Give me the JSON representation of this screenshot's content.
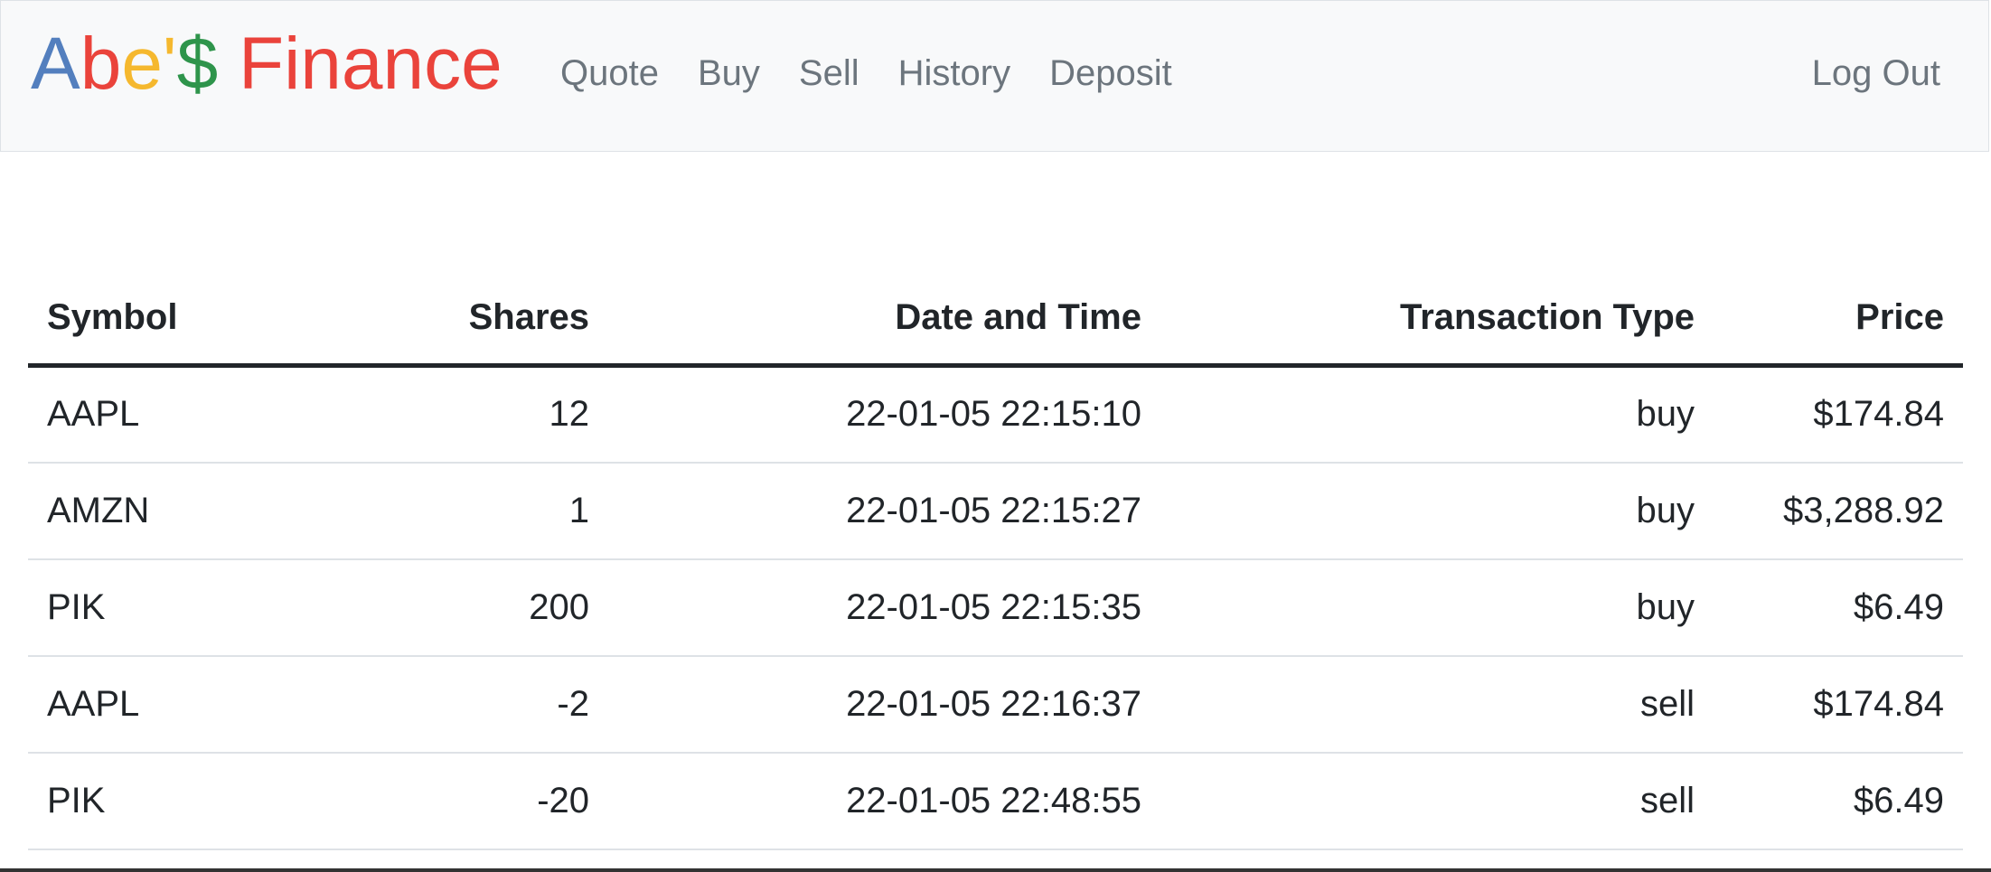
{
  "brand": {
    "letters": [
      {
        "char": "A",
        "color": "#537fbe"
      },
      {
        "char": "b",
        "color": "#ea433b"
      },
      {
        "char": "e",
        "color": "#f5b82e"
      },
      {
        "char": "'",
        "color": "#f5b82e"
      },
      {
        "char": "$",
        "color": "#2e944b"
      },
      {
        "char": " ",
        "color": "#ea433b"
      },
      {
        "char": "Finance",
        "color": "#ea433b"
      }
    ]
  },
  "nav": {
    "items": [
      {
        "label": "Quote"
      },
      {
        "label": "Buy"
      },
      {
        "label": "Sell"
      },
      {
        "label": "History"
      },
      {
        "label": "Deposit"
      }
    ],
    "logout_label": "Log Out"
  },
  "table": {
    "headers": [
      "Symbol",
      "Shares",
      "Date and Time",
      "Transaction Type",
      "Price"
    ],
    "rows": [
      {
        "symbol": "AAPL",
        "shares": "12",
        "datetime": "22-01-05 22:15:10",
        "type": "buy",
        "price": "$174.84"
      },
      {
        "symbol": "AMZN",
        "shares": "1",
        "datetime": "22-01-05 22:15:27",
        "type": "buy",
        "price": "$3,288.92"
      },
      {
        "symbol": "PIK",
        "shares": "200",
        "datetime": "22-01-05 22:15:35",
        "type": "buy",
        "price": "$6.49"
      },
      {
        "symbol": "AAPL",
        "shares": "-2",
        "datetime": "22-01-05 22:16:37",
        "type": "sell",
        "price": "$174.84"
      },
      {
        "symbol": "PIK",
        "shares": "-20",
        "datetime": "22-01-05 22:48:55",
        "type": "sell",
        "price": "$6.49"
      }
    ]
  }
}
